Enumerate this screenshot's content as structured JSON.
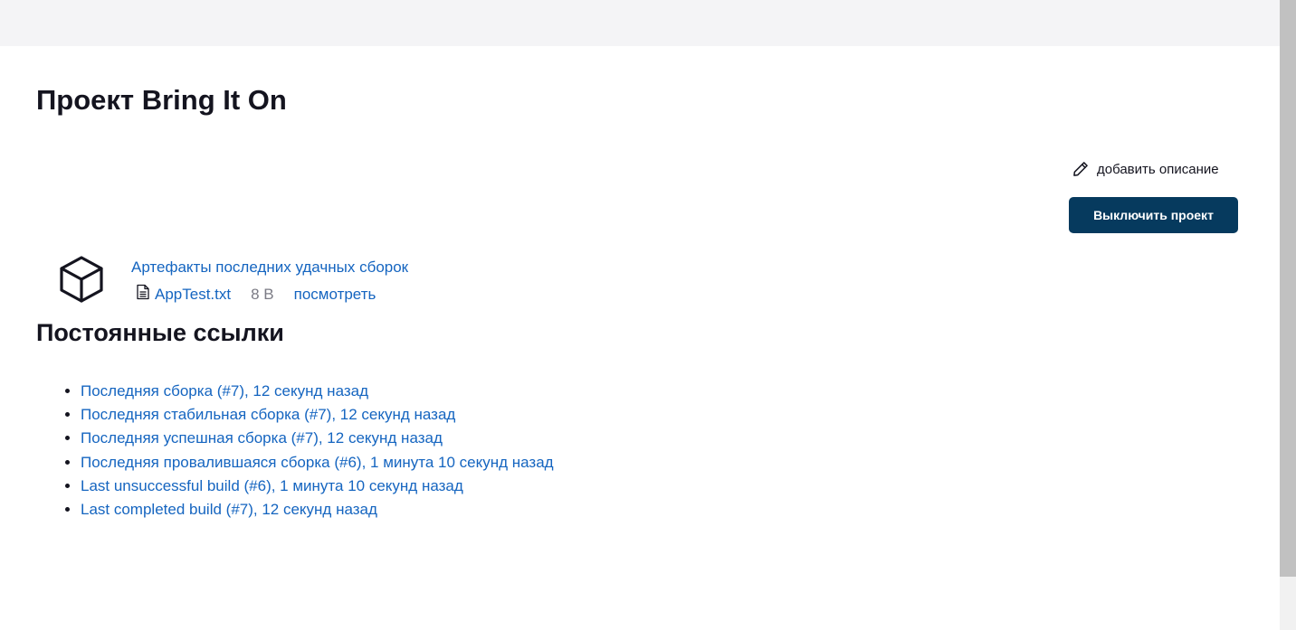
{
  "page": {
    "title": "Проект Bring It On"
  },
  "actions": {
    "add_description": "добавить описание",
    "disable_project": "Выключить проект"
  },
  "artifacts": {
    "title": "Артефакты последних удачных сборок",
    "file_name": "AppTest.txt",
    "file_size": "8 B",
    "view_label": "посмотреть"
  },
  "permalinks": {
    "title": "Постоянные ссылки",
    "items": [
      "Последняя сборка (#7), 12 секунд назад",
      "Последняя стабильная сборка (#7), 12 секунд назад",
      "Последняя успешная сборка (#7), 12 секунд назад",
      "Последняя провалившаяся сборка (#6), 1 минута 10 секунд назад",
      "Last unsuccessful build (#6), 1 минута 10 секунд назад",
      "Last completed build (#7), 12 секунд назад"
    ]
  },
  "icons": {
    "edit": "pencil-icon",
    "artifact": "package-icon",
    "file": "document-icon"
  },
  "colors": {
    "link": "#1565c0",
    "primary_button": "#063a5e",
    "topbar": "#f4f4f6"
  }
}
